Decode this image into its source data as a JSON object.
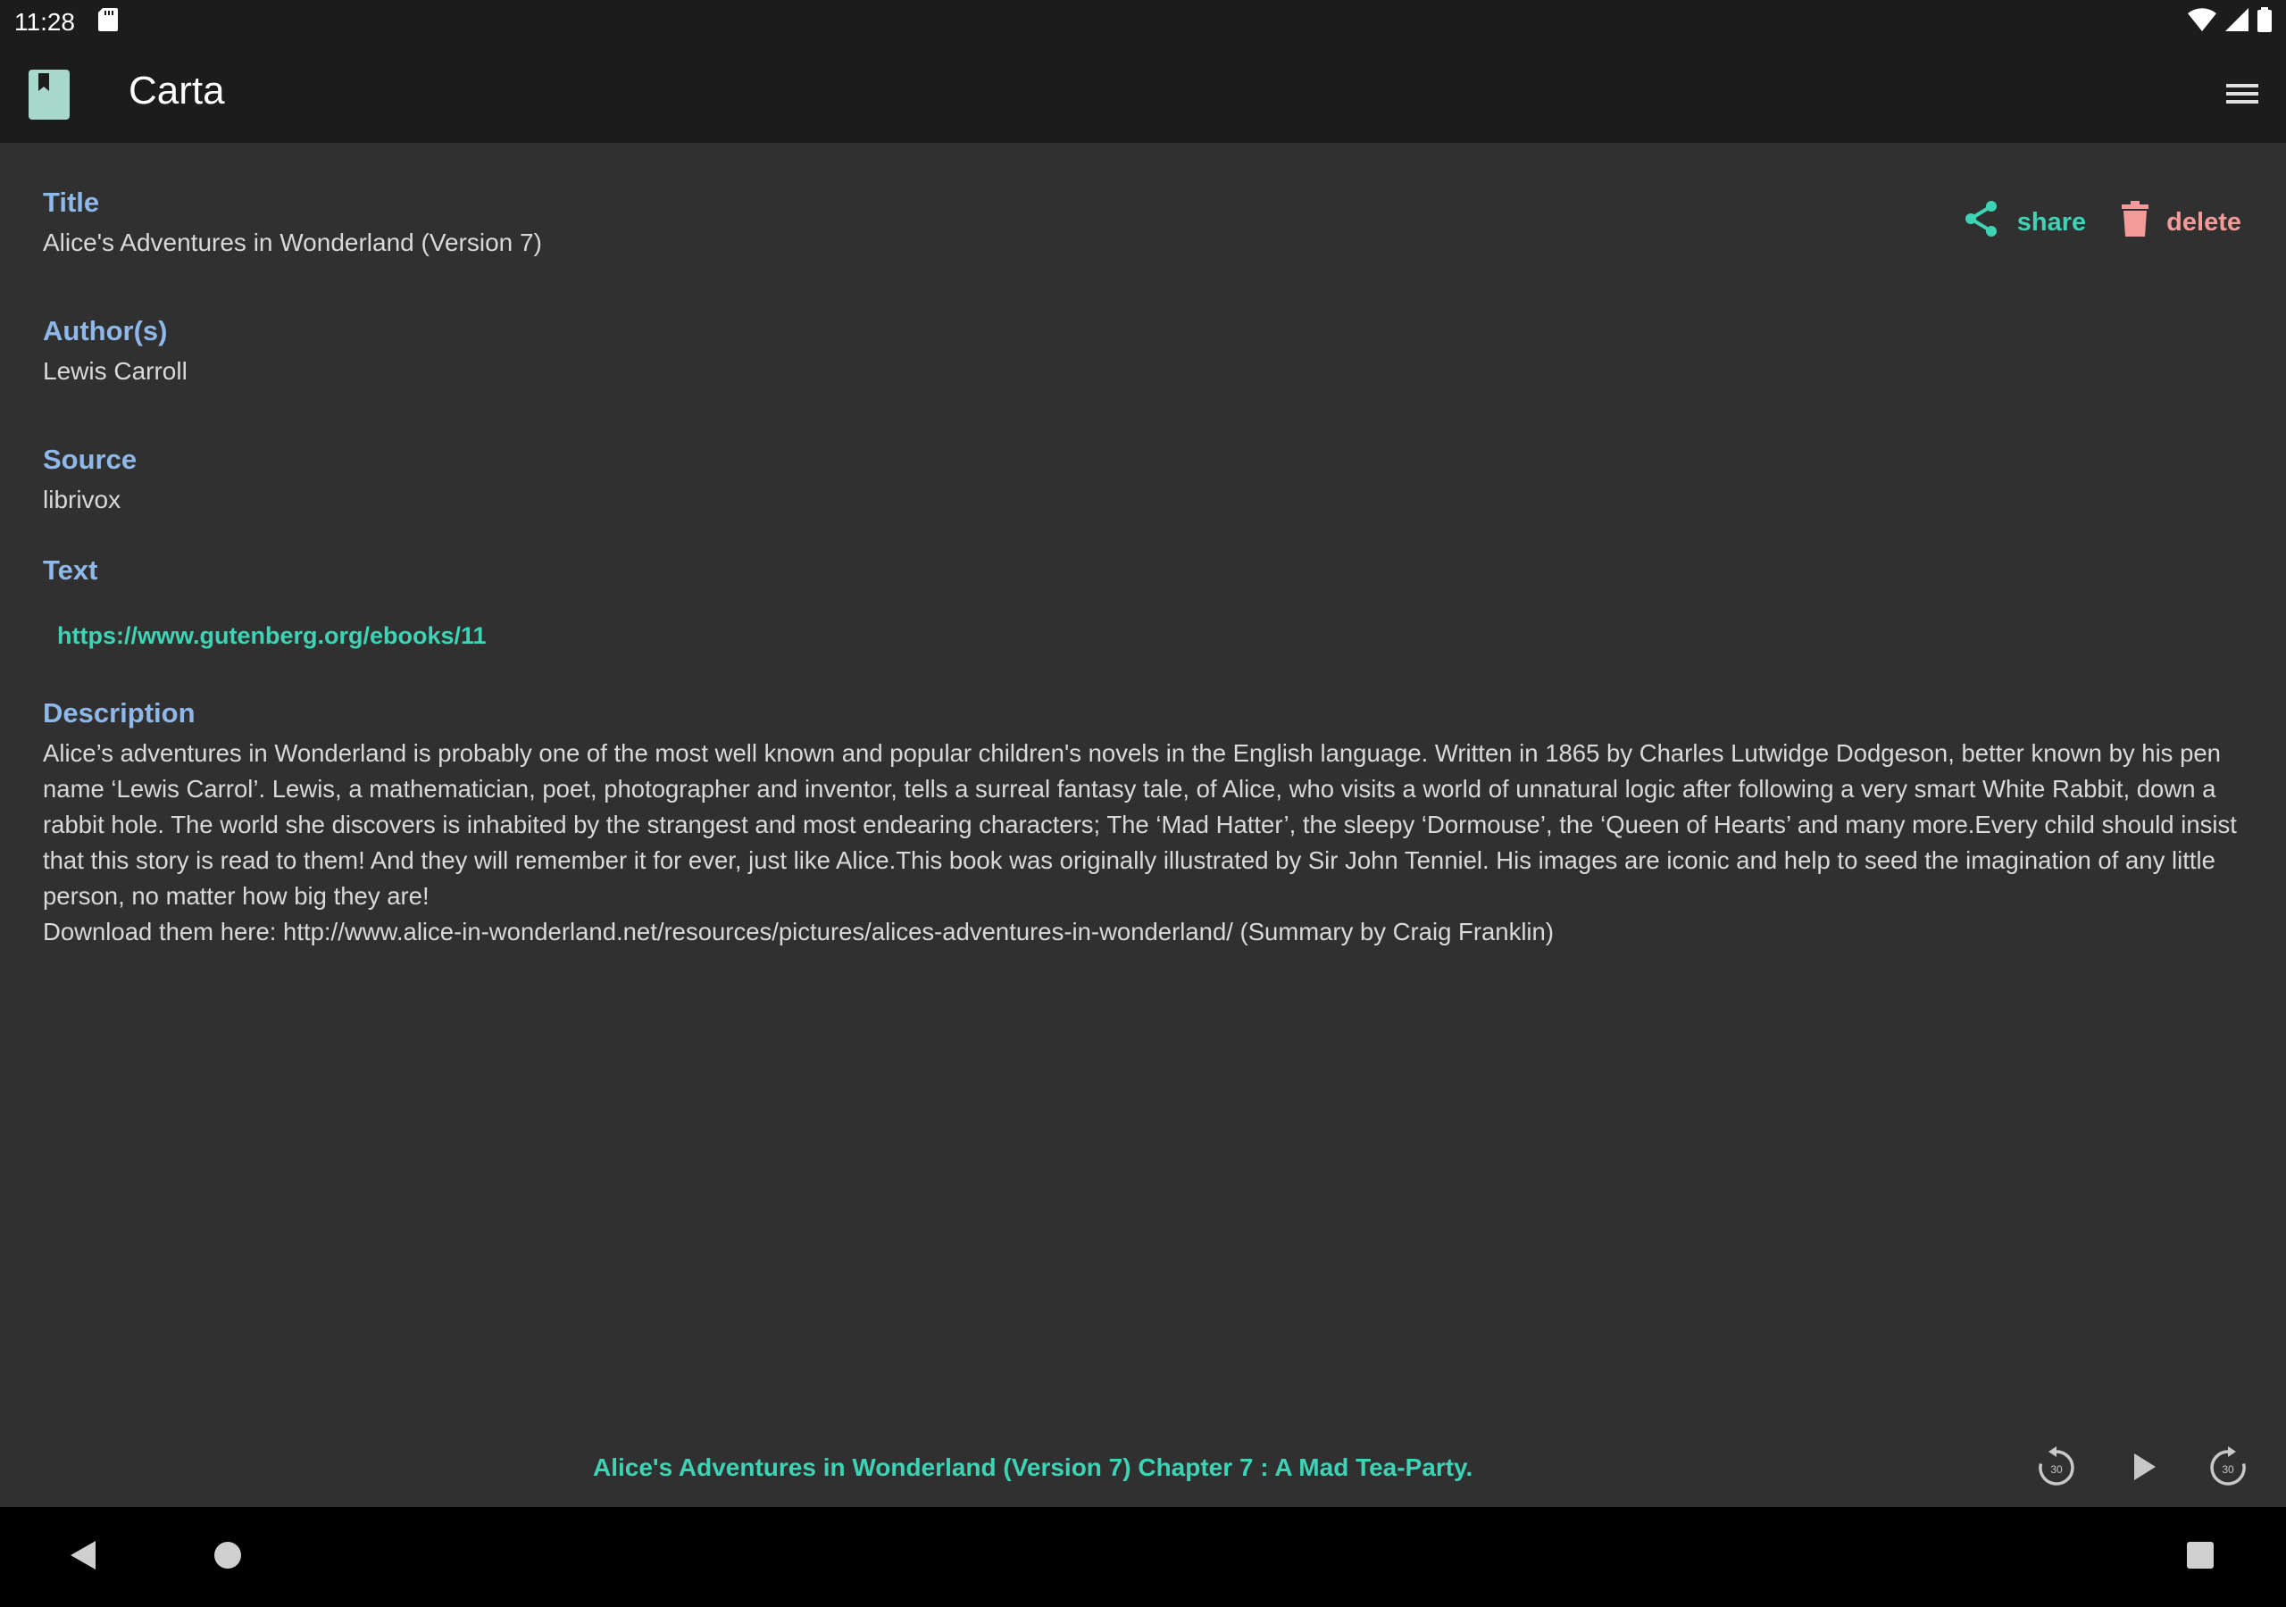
{
  "status": {
    "time": "11:28",
    "icons": [
      "sd-card-icon",
      "wifi-icon",
      "signal-icon",
      "battery-icon"
    ]
  },
  "app": {
    "title": "Carta",
    "logo_icon": "book-icon",
    "menu_icon": "hamburger-menu-icon"
  },
  "book": {
    "title_label": "Title",
    "title": "Alice's Adventures in Wonderland (Version 7)",
    "author_label": "Author(s)",
    "author": "Lewis Carroll",
    "source_label": "Source",
    "source": "librivox",
    "text_label": "Text",
    "text_link": "https://www.gutenberg.org/ebooks/11",
    "description_label": "Description",
    "description_line1": "Alice’s adventures in Wonderland is probably one of the most well known and popular children's novels in the English language. Written in 1865 by Charles Lutwidge Dodgeson, better known by his pen name ‘Lewis Carrol’. Lewis, a mathematician, poet, photographer and inventor, tells a surreal fantasy tale, of Alice, who visits a world of unnatural logic after following a very smart White Rabbit, down a rabbit hole. The world she discovers is inhabited by the strangest and most endearing characters; The ‘Mad Hatter’, the sleepy ‘Dormouse’, the ‘Queen of Hearts’ and many more.Every child should insist that this story is read to them! And they will remember it for ever, just like Alice.This book was originally illustrated by Sir John Tenniel. His images are iconic and help to seed the imagination of any little person, no matter how big they are!",
    "description_line2": "Download them here: http://www.alice-in-wonderland.net/resources/pictures/alices-adventures-in-wonderland/ (Summary by Craig Franklin)"
  },
  "actions": {
    "share_label": "share",
    "delete_label": "delete"
  },
  "player": {
    "now_playing": "Alice's Adventures in Wonderland (Version 7) Chapter 7 : A Mad Tea-Party.",
    "rewind_seconds": "30",
    "forward_seconds": "30"
  },
  "colors": {
    "accent": "#3ed3b4",
    "label": "#8fb8ea",
    "delete": "#f39a9a",
    "background": "#303030",
    "bar": "#1c1c1c"
  }
}
